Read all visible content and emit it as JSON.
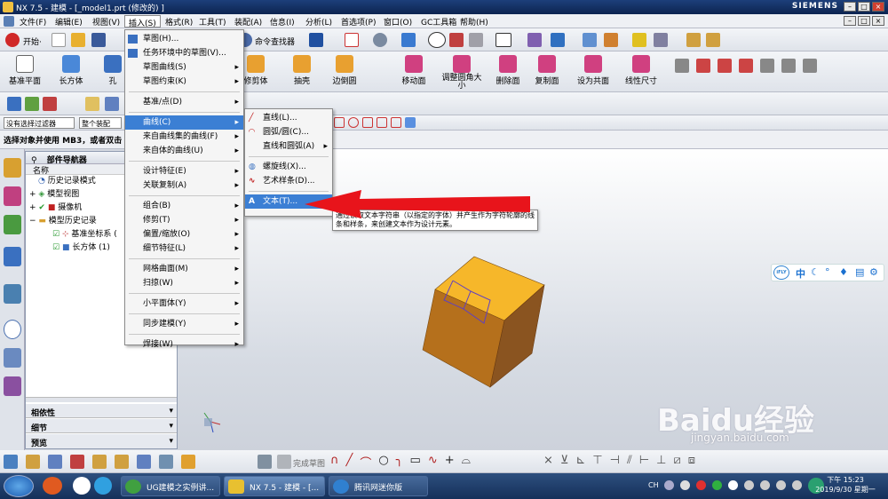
{
  "window": {
    "title": "NX 7.5 - 建模 - [_model1.prt  (修改的) ]",
    "brand": "SIEMENS"
  },
  "menubar": [
    "文件(F)",
    "编辑(E)",
    "视图(V)",
    "插入(S)",
    "格式(R)",
    "工具(T)",
    "装配(A)",
    "信息(I)",
    "分析(L)",
    "首选项(P)",
    "窗口(O)",
    "GC工具箱",
    "帮助(H)"
  ],
  "toolbar1": {
    "start": "开始·",
    "command_finder": "命令查找器"
  },
  "toolbar2": {
    "left": [
      "基准平面",
      "长方体",
      "孔"
    ],
    "middle": [
      "修剪体",
      "抽壳",
      "边倒圆"
    ],
    "sync": [
      "移动面",
      "调整圆角大小",
      "删除面",
      "复制面",
      "设为共面",
      "线性尺寸"
    ]
  },
  "filters": {
    "selection_filter": "没有选择过滤器",
    "assembly": "整个装配"
  },
  "status_text": "选择对象并使用 MB3，或者双击",
  "navigator": {
    "title": "部件导航器",
    "column": "名称",
    "items": [
      "历史记录模式",
      "模型视图",
      "摄像机",
      "模型历史记录",
      "基准坐标系 (",
      "长方体 (1)"
    ],
    "panels": [
      "相依性",
      "细节",
      "预览"
    ]
  },
  "insert_menu": [
    {
      "label": "草图(H)...",
      "arrow": false
    },
    {
      "label": "任务环境中的草图(V)...",
      "arrow": false
    },
    {
      "label": "草图曲线(S)",
      "arrow": true
    },
    {
      "label": "草图约束(K)",
      "arrow": true
    },
    {
      "label": "基准/点(D)",
      "arrow": true
    },
    {
      "label": "曲线(C)",
      "arrow": true
    },
    {
      "label": "来自曲线集的曲线(F)",
      "arrow": true
    },
    {
      "label": "来自体的曲线(U)",
      "arrow": true
    },
    {
      "label": "设计特征(E)",
      "arrow": true
    },
    {
      "label": "关联复制(A)",
      "arrow": true
    },
    {
      "label": "组合(B)",
      "arrow": true
    },
    {
      "label": "修剪(T)",
      "arrow": true
    },
    {
      "label": "偏置/缩放(O)",
      "arrow": true
    },
    {
      "label": "细节特征(L)",
      "arrow": true
    },
    {
      "label": "网格曲面(M)",
      "arrow": true
    },
    {
      "label": "扫掠(W)",
      "arrow": true
    },
    {
      "label": "小平面体(Y)",
      "arrow": true
    },
    {
      "label": "同步建模(Y)",
      "arrow": true
    },
    {
      "label": "焊接(W)",
      "arrow": true
    }
  ],
  "curve_submenu": [
    {
      "label": "直线(L)...",
      "arrow": false
    },
    {
      "label": "圆弧/圆(C)...",
      "arrow": false
    },
    {
      "label": "直线和圆弧(A)",
      "arrow": true
    },
    {
      "label": "螺旋线(X)...",
      "arrow": false
    },
    {
      "label": "艺术样条(D)...",
      "arrow": false
    },
    {
      "label": "文本(T)...",
      "arrow": false
    }
  ],
  "tooltip": "通过读取文本字符串（以指定的字体）并产生作为字符轮廓的线条和样条，来创建文本作为设计元素。",
  "sketch_toolbar": {
    "finish": "完成草图"
  },
  "ime_label": "中",
  "taskbar": {
    "tasks": [
      "UG建模之实例讲...",
      "NX 7.5 - 建模 - [...",
      "腾讯网迷你版"
    ],
    "lang": "CH",
    "time": "下午 15:23",
    "date": "2019/9/30 星期一"
  },
  "watermark": {
    "brand": "Baidu经验",
    "url": "jingyan.baidu.com"
  },
  "colors": {
    "highlight": "#3b7fd4",
    "arrow": "#e8141b",
    "cube_top": "#f6b72a",
    "cube_side": "#b5701c",
    "cube_front": "#8a5420"
  }
}
